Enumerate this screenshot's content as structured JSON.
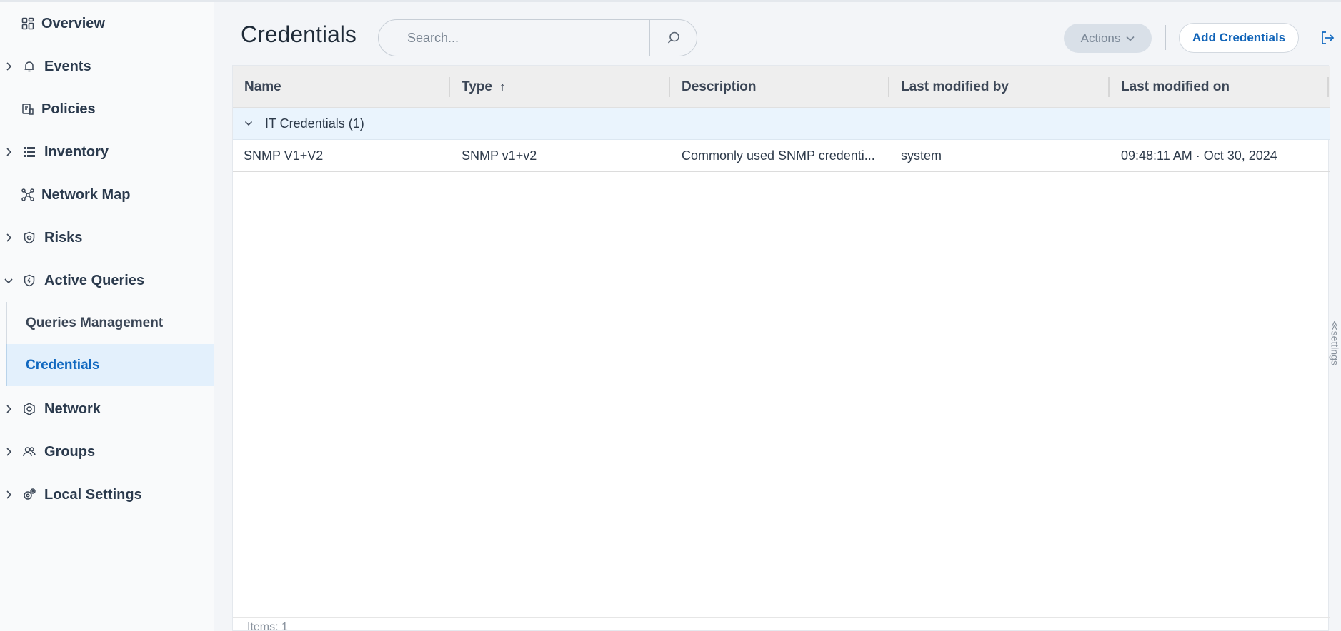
{
  "sidebar": {
    "items": [
      {
        "label": "Overview",
        "icon": "dashboard-icon",
        "expandable": false
      },
      {
        "label": "Events",
        "icon": "bell-icon",
        "expandable": true
      },
      {
        "label": "Policies",
        "icon": "policies-icon",
        "expandable": false
      },
      {
        "label": "Inventory",
        "icon": "list-icon",
        "expandable": true
      },
      {
        "label": "Network Map",
        "icon": "network-map-icon",
        "expandable": false
      },
      {
        "label": "Risks",
        "icon": "shield-icon",
        "expandable": true
      },
      {
        "label": "Active Queries",
        "icon": "shield-bolt-icon",
        "expandable": true,
        "expanded": true
      },
      {
        "label": "Network",
        "icon": "network-gear-icon",
        "expandable": true
      },
      {
        "label": "Groups",
        "icon": "users-icon",
        "expandable": true
      },
      {
        "label": "Local Settings",
        "icon": "gears-icon",
        "expandable": true
      }
    ],
    "subitems": [
      {
        "label": "Queries Management",
        "active": false
      },
      {
        "label": "Credentials",
        "active": true
      }
    ]
  },
  "header": {
    "title": "Credentials",
    "search_placeholder": "Search...",
    "actions_label": "Actions",
    "add_label": "Add Credentials"
  },
  "table": {
    "columns": [
      "Name",
      "Type",
      "Description",
      "Last modified by",
      "Last modified on"
    ],
    "sort_indicator": "↑",
    "group": {
      "label": "IT Credentials",
      "count": "(1)"
    },
    "rows": [
      {
        "name": "SNMP V1+V2",
        "type": "SNMP v1+v2",
        "description": "Commonly used SNMP credenti...",
        "modified_by": "system",
        "modified_on": "09:48:11 AM · Oct 30, 2024"
      }
    ],
    "footer": "Items: 1"
  },
  "settings_tab": "≪settings",
  "colors": {
    "accent": "#1068c0",
    "active_bg": "#e3f0fc",
    "group_bg": "#eaf4fd",
    "header_bg": "#eeeeee"
  }
}
